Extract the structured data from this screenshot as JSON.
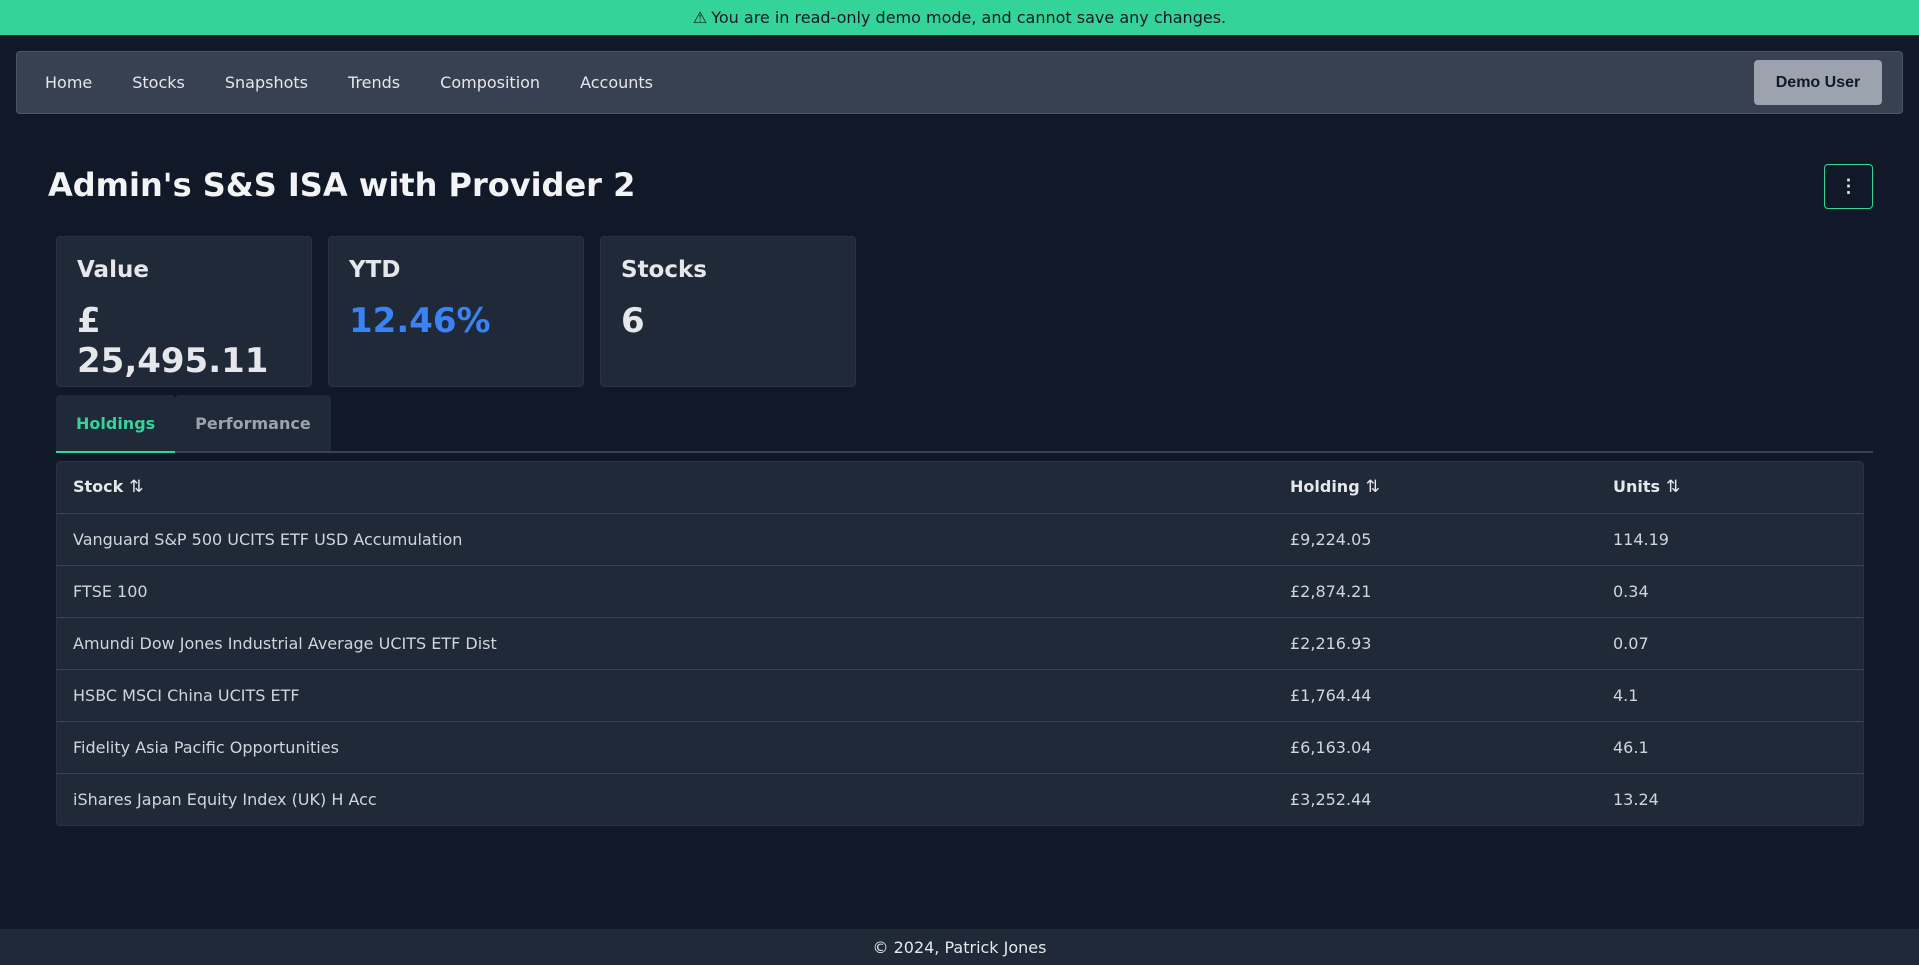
{
  "banner": {
    "icon": "warning-triangle-icon",
    "text": "You are in read-only demo mode, and cannot save any changes."
  },
  "nav": {
    "links": [
      "Home",
      "Stocks",
      "Snapshots",
      "Trends",
      "Composition",
      "Accounts"
    ],
    "user_label": "Demo User"
  },
  "page": {
    "title": "Admin's S&S ISA with Provider 2",
    "menu_icon": "kebab-menu-icon"
  },
  "cards": [
    {
      "label": "Value",
      "value": "£ 25,495.11"
    },
    {
      "label": "YTD",
      "value": "12.46%"
    },
    {
      "label": "Stocks",
      "value": "6"
    }
  ],
  "tabs": [
    {
      "label": "Holdings",
      "active": true
    },
    {
      "label": "Performance",
      "active": false
    }
  ],
  "table": {
    "headers": [
      "Stock",
      "Holding",
      "Units"
    ],
    "sort_icon": "sort-arrows-icon",
    "rows": [
      [
        "Vanguard S&P 500 UCITS ETF USD Accumulation",
        "£9,224.05",
        "114.19"
      ],
      [
        "FTSE 100",
        "£2,874.21",
        "0.34"
      ],
      [
        "Amundi Dow Jones Industrial Average UCITS ETF Dist",
        "£2,216.93",
        "0.07"
      ],
      [
        "HSBC MSCI China UCITS ETF",
        "£1,764.44",
        "4.1"
      ],
      [
        "Fidelity Asia Pacific Opportunities",
        "£6,163.04",
        "46.1"
      ],
      [
        "iShares Japan Equity Index (UK) H Acc",
        "£3,252.44",
        "13.24"
      ]
    ]
  },
  "footer": {
    "text": "© 2024, Patrick Jones"
  },
  "colors": {
    "accent": "#34d399",
    "ytd": "#3b82f6",
    "background": "#111827",
    "panel": "#1f2937"
  }
}
